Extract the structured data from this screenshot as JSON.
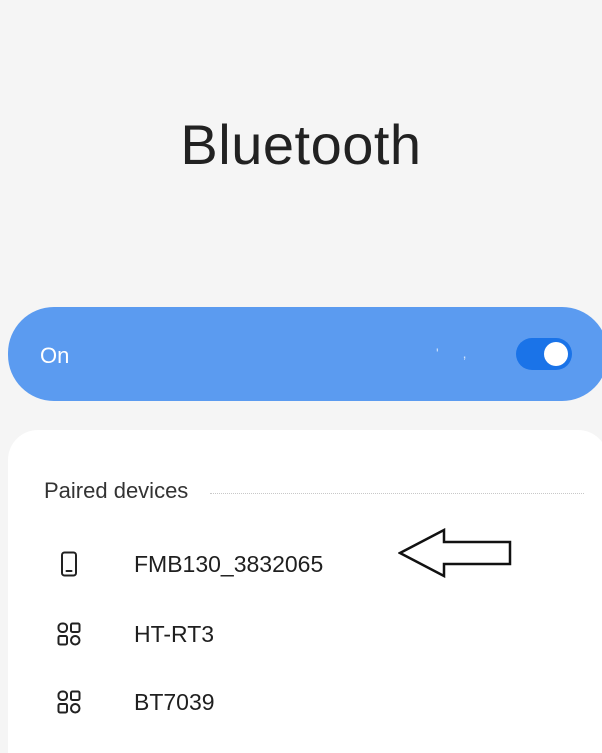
{
  "header": {
    "title": "Bluetooth"
  },
  "toggle": {
    "label": "On",
    "faint_text": "' ,",
    "state": "on",
    "bar_color": "#5b9bf0",
    "switch_color": "#1a73e8"
  },
  "paired": {
    "title": "Paired devices",
    "devices": [
      {
        "name": "FMB130_3832065",
        "icon": "phone-icon"
      },
      {
        "name": "HT-RT3",
        "icon": "device-grid-icon"
      },
      {
        "name": "BT7039",
        "icon": "device-grid-icon"
      }
    ]
  },
  "annotation": {
    "icon": "arrow-left-icon"
  }
}
